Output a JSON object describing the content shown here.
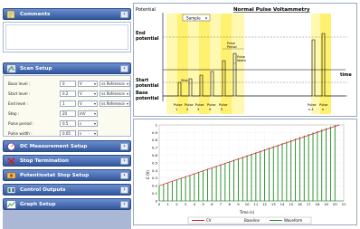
{
  "left": {
    "comments": {
      "title": "Comments"
    },
    "scan_setup": {
      "title": "Scan Setup",
      "rows": [
        {
          "label": "Base level :",
          "value": "0",
          "unit": "V",
          "ref": "vs Reference"
        },
        {
          "label": "Start level :",
          "value": "0.2",
          "unit": "V",
          "ref": "vs Reference"
        },
        {
          "label": "End level :",
          "value": "1",
          "unit": "V",
          "ref": "vs Reference"
        },
        {
          "label": "Step :",
          "value": "20",
          "unit": "mV",
          "ref": ""
        },
        {
          "label": "Pulse period :",
          "value": "0.5",
          "unit": "s",
          "ref": ""
        },
        {
          "label": "Pulse width :",
          "value": "0.05",
          "unit": "s",
          "ref": ""
        }
      ]
    },
    "sections": [
      {
        "title": "DC Measurement Setup"
      },
      {
        "title": "Stop Termination"
      },
      {
        "title": "Potentiostat Stop Setup"
      },
      {
        "title": "Control Outputs"
      },
      {
        "title": "Graph Setup"
      }
    ]
  },
  "diagram": {
    "title": "Normal Pulse Voltammetry",
    "potential_label": "Potential",
    "sample_label": "Sample",
    "end_potential": [
      "End",
      "potential"
    ],
    "start_potential": [
      "Start",
      "potential"
    ],
    "base_potential": [
      "Base",
      "potential"
    ],
    "time_label": "time",
    "step_label": "Step",
    "pulse_period_label": [
      "Pulse",
      "Period"
    ],
    "pulse_width_label": [
      "Pulse",
      "Width"
    ],
    "pulse_labels": [
      [
        "Pulse",
        "1"
      ],
      [
        "Pulse",
        "2"
      ],
      [
        "Pulse",
        "3"
      ],
      [
        "Pulse",
        "4"
      ],
      [
        "Pulse",
        "5"
      ],
      [
        "Pulse",
        "n-1"
      ],
      [
        "Pulse",
        "n"
      ]
    ]
  },
  "chart_data": {
    "type": "line",
    "xlabel": "Time (s)",
    "ylabel": "E (V)",
    "xlim": [
      0,
      21
    ],
    "ylim": [
      0,
      1
    ],
    "x_ticks": [
      "0",
      "1",
      "2",
      "3",
      "4",
      "5",
      "6",
      "7",
      "8",
      "9",
      "10",
      "11",
      "12",
      "13",
      "14",
      "15",
      "16",
      "17",
      "18",
      "19",
      "20",
      "21"
    ],
    "y_ticks": [
      "0",
      "0.1",
      "0.2",
      "0.3",
      "0.4",
      "0.5",
      "0.6",
      "0.7",
      "0.8",
      "0.9",
      "1"
    ],
    "series": [
      {
        "name": "CV",
        "color": "#cc2222",
        "x": [
          0,
          20.5
        ],
        "y": [
          0.2,
          1.0
        ]
      },
      {
        "name": "Baseline",
        "color": "#ffffff",
        "x": [
          0,
          21
        ],
        "y": [
          0,
          0
        ]
      },
      {
        "name": "Waveform",
        "color": "#1e8a1e",
        "pulse_period": 0.5,
        "pulse_width": 0.05,
        "base": 0,
        "start": 0.2,
        "end": 1.0,
        "step": 0.02
      }
    ],
    "legend_position": "bottom"
  }
}
